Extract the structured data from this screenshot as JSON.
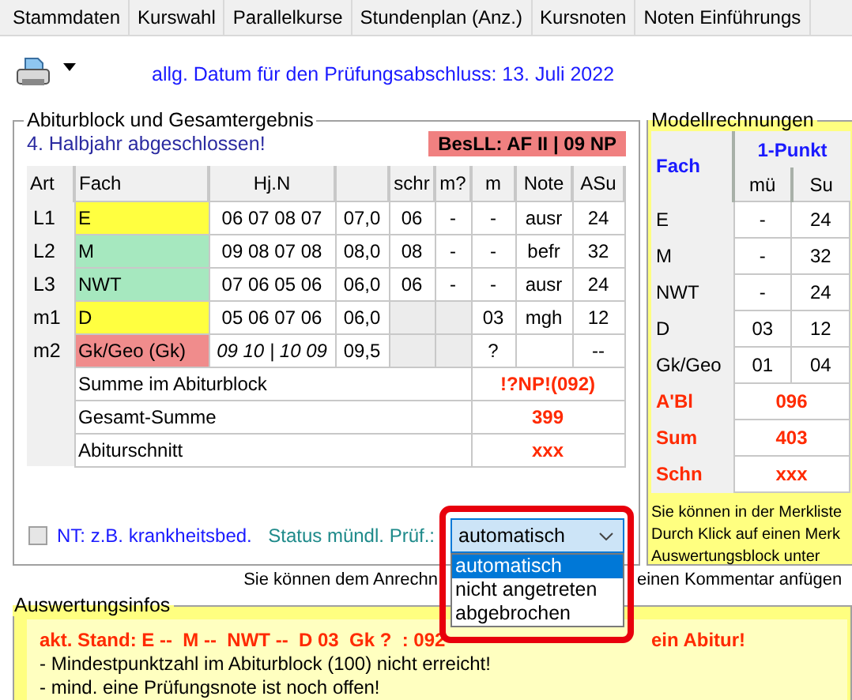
{
  "tabs": [
    {
      "label": "Stammdaten",
      "selected": false
    },
    {
      "label": "Kurswahl",
      "selected": false
    },
    {
      "label": "Parallelkurse",
      "selected": false
    },
    {
      "label": "Stundenplan (Anz.)",
      "selected": false
    },
    {
      "label": "Kursnoten",
      "selected": false
    },
    {
      "label": "Noten Einführungs",
      "selected": false
    }
  ],
  "toolbar": {
    "date_text": "allg. Datum für den Prüfungsabschluss: 13. Juli 2022"
  },
  "abitur": {
    "legend": "Abiturblock und Gesamtergebnis",
    "status": "4. Halbjahr abgeschlossen!",
    "badge": "BesLL: AF II | 09 NP",
    "columns": [
      "Art",
      "Fach",
      "Hj.N",
      "schr",
      "m?",
      "m",
      "Note",
      "ASu"
    ],
    "rows": [
      {
        "art": "L1",
        "fach": "E",
        "color": "#ffff40",
        "hj": "06 07 08 07",
        "italic": false,
        "avg": "07,0",
        "schr": "06",
        "mq": "-",
        "m": "-",
        "note": "ausr",
        "asu": "24"
      },
      {
        "art": "L2",
        "fach": "M",
        "color": "#a6e8bf",
        "hj": "09 08 07 08",
        "italic": false,
        "avg": "08,0",
        "schr": "08",
        "mq": "-",
        "m": "-",
        "note": "befr",
        "asu": "32"
      },
      {
        "art": "L3",
        "fach": "NWT",
        "color": "#a6e8bf",
        "hj": "07 06 05 06",
        "italic": false,
        "avg": "06,0",
        "schr": "06",
        "mq": "-",
        "m": "-",
        "note": "ausr",
        "asu": "24"
      },
      {
        "art": "m1",
        "fach": "D",
        "color": "#ffff40",
        "hj": "05 06 07 06",
        "italic": false,
        "avg": "06,0",
        "m": "03",
        "note": "mgh",
        "asu": "12"
      },
      {
        "art": "m2",
        "fach": "Gk/Geo (Gk)",
        "color": "#f08c8c",
        "hj": "09 10 | 10 09",
        "italic": true,
        "avg": "09,5",
        "m": "?",
        "asu": "--"
      }
    ],
    "summary": [
      {
        "label": "Summe im Abiturblock",
        "value": "!?NP!(092)"
      },
      {
        "label": "Gesamt-Summe",
        "value": "399"
      },
      {
        "label": "Abiturschnitt",
        "value": "xxx"
      }
    ],
    "nt_checkbox": {
      "label": "NT: z.B. krankheitsbed.",
      "checked": false
    },
    "status_label": "Status mündl. Prüf.:",
    "status_select": {
      "value": "automatisch",
      "options": [
        {
          "label": "automatisch",
          "selected": true
        },
        {
          "label": "nicht angetreten",
          "selected": false
        },
        {
          "label": "abgebrochen",
          "selected": false
        }
      ]
    }
  },
  "model": {
    "legend": "Modellrechnungen",
    "fach_header": "Fach",
    "group_header": "1-Punkt",
    "sub_headers": [
      "mü",
      "Su"
    ],
    "rows": [
      {
        "fach": "E",
        "mu": "-",
        "su": "24"
      },
      {
        "fach": "M",
        "mu": "-",
        "su": "32"
      },
      {
        "fach": "NWT",
        "mu": "-",
        "su": "24"
      },
      {
        "fach": "D",
        "mu": "03",
        "su": "12"
      },
      {
        "fach": "Gk/Geo",
        "mu": "01",
        "su": "04"
      }
    ],
    "summary": [
      {
        "label": "A'Bl",
        "value": "096"
      },
      {
        "label": "Sum",
        "value": "403"
      },
      {
        "label": "Schn",
        "value": "xxx"
      }
    ],
    "notes": [
      "Sie können in der Merkliste",
      "Durch Klick auf einen Merk",
      "Auswertungsblock unter"
    ]
  },
  "comment_hint": [
    "Sie können dem Anrechn",
    "einen Kommentar anfügen"
  ],
  "infos": {
    "legend": "Auswertungsinfos",
    "status_line": [
      "akt. Stand: E --  M --  NWT --  D 03  Gk ?  : 092",
      "ein Abitur!"
    ],
    "lines": [
      "- Mindestpunktzahl im Abiturblock (100) nicht erreicht!",
      "- mind. eine Prüfungsnote ist noch offen!"
    ]
  }
}
